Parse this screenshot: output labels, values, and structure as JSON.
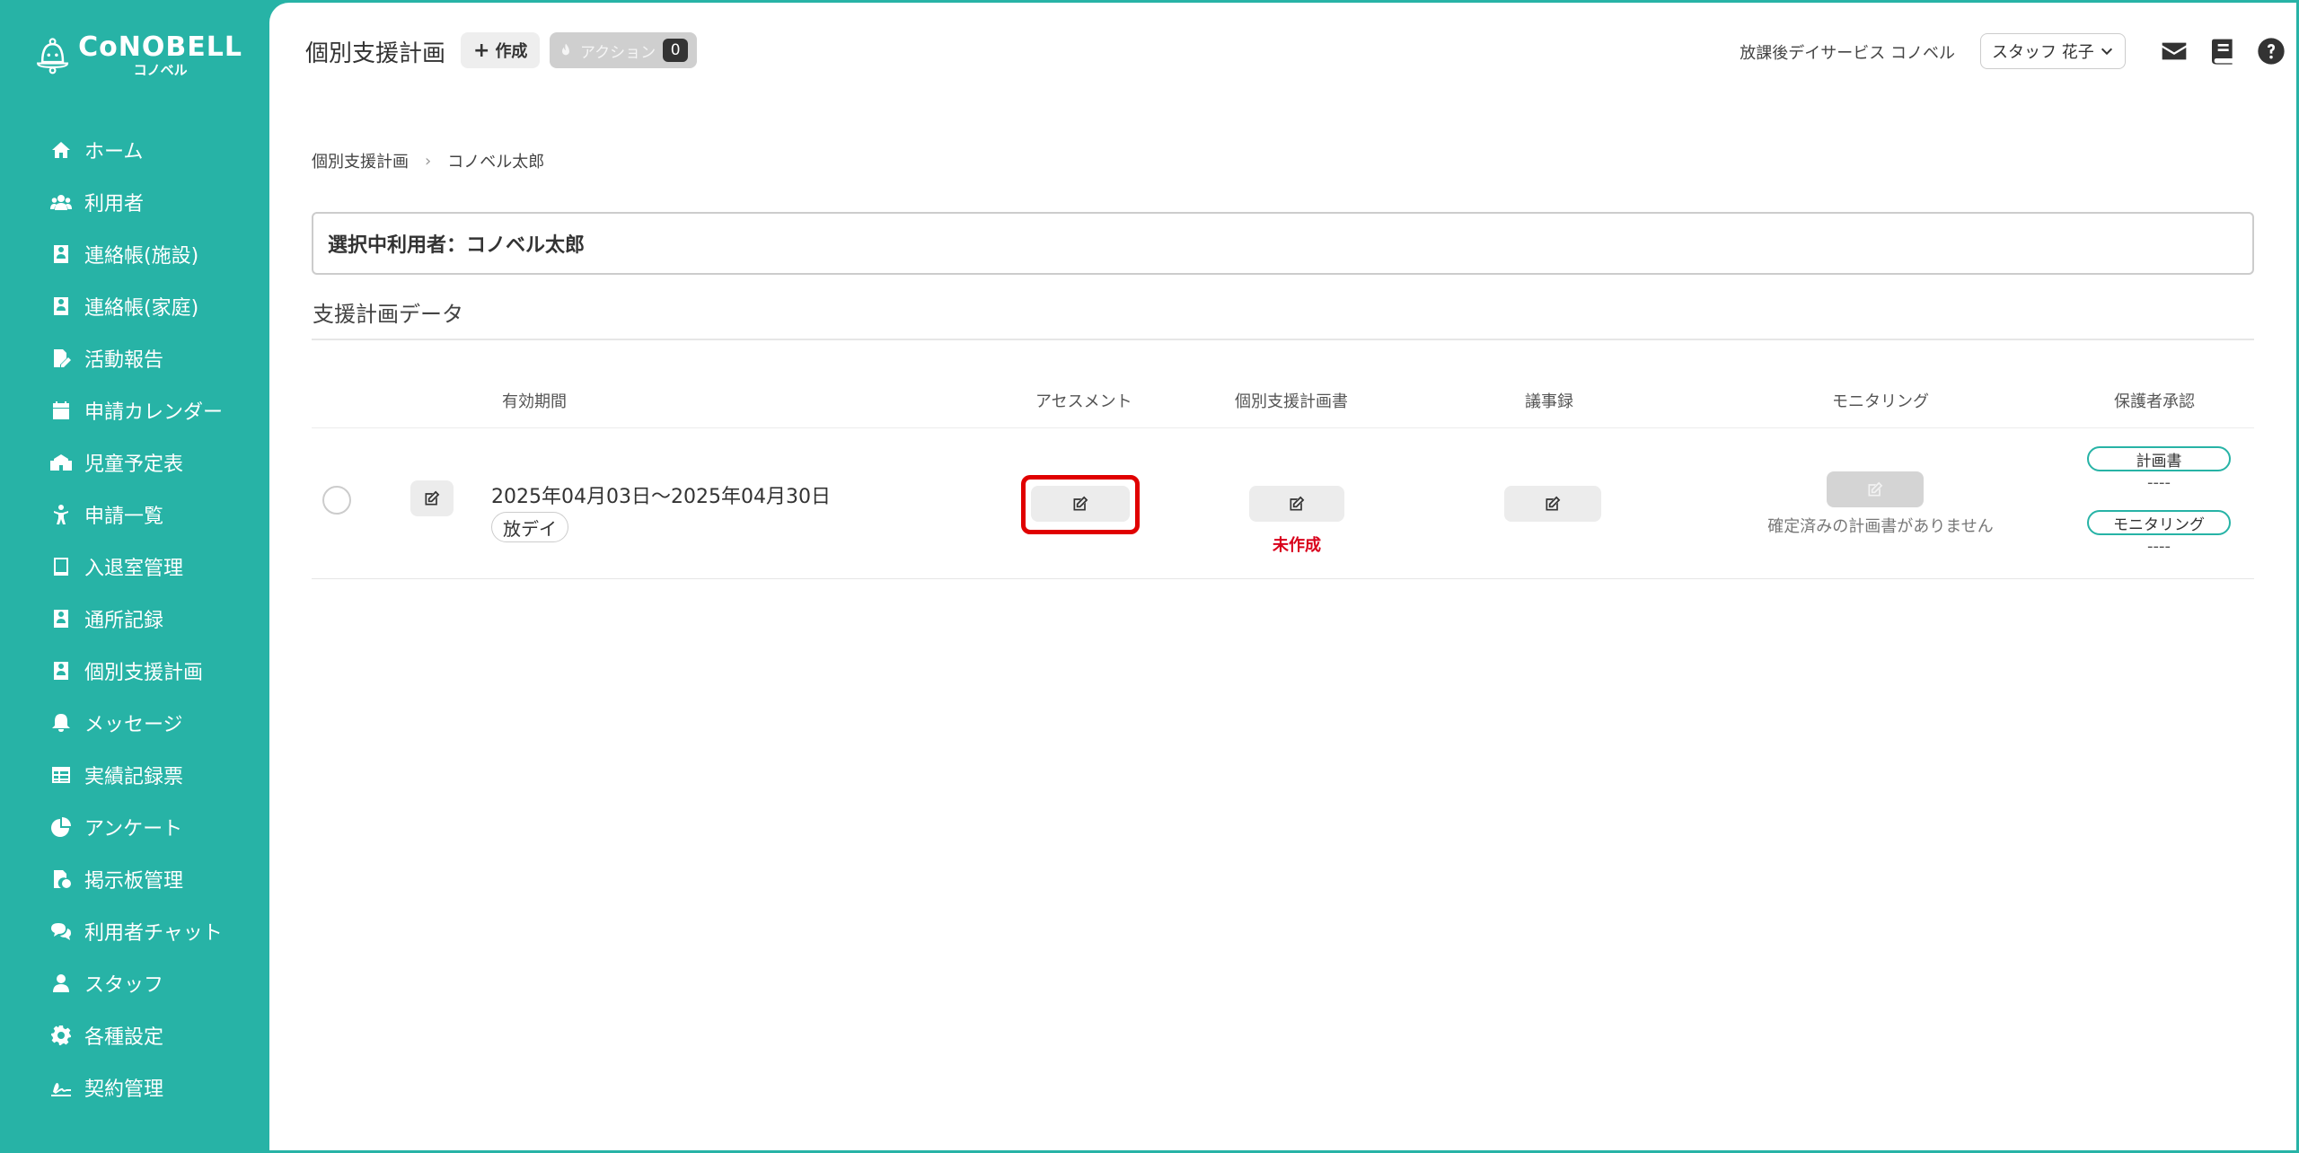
{
  "logo": {
    "main": "CoNOBELL",
    "sub": "コノベル"
  },
  "sidebar": {
    "items": [
      {
        "label": "ホーム",
        "icon": "home-icon"
      },
      {
        "label": "利用者",
        "icon": "users-icon"
      },
      {
        "label": "連絡帳(施設)",
        "icon": "contact-book-icon"
      },
      {
        "label": "連絡帳(家庭)",
        "icon": "contact-book-icon"
      },
      {
        "label": "活動報告",
        "icon": "report-edit-icon"
      },
      {
        "label": "申請カレンダー",
        "icon": "calendar-icon"
      },
      {
        "label": "児童予定表",
        "icon": "school-icon"
      },
      {
        "label": "申請一覧",
        "icon": "child-icon"
      },
      {
        "label": "入退室管理",
        "icon": "tablet-icon"
      },
      {
        "label": "通所記録",
        "icon": "contact-book-icon"
      },
      {
        "label": "個別支援計画",
        "icon": "contact-book-icon"
      },
      {
        "label": "メッセージ",
        "icon": "bell-icon"
      },
      {
        "label": "実績記録票",
        "icon": "table-icon"
      },
      {
        "label": "アンケート",
        "icon": "pie-chart-icon"
      },
      {
        "label": "掲示板管理",
        "icon": "file-settings-icon"
      },
      {
        "label": "利用者チャット",
        "icon": "chat-icon"
      },
      {
        "label": "スタッフ",
        "icon": "staff-icon"
      },
      {
        "label": "各種設定",
        "icon": "gear-icon"
      },
      {
        "label": "契約管理",
        "icon": "signature-icon"
      }
    ]
  },
  "header": {
    "title": "個別支援計画",
    "create_label": "作成",
    "action_label": "アクション",
    "action_count": "0",
    "facility": "放課後デイサービス コノベル",
    "staff": "スタッフ 花子"
  },
  "breadcrumb": {
    "root": "個別支援計画",
    "current": "コノベル太郎"
  },
  "selected_user": "選択中利用者：コノベル太郎",
  "section_title": "支援計画データ",
  "table": {
    "headers": {
      "period": "有効期間",
      "assessment": "アセスメント",
      "plan": "個別支援計画書",
      "minutes": "議事録",
      "monitoring": "モニタリング",
      "approval": "保護者承認"
    },
    "rows": [
      {
        "period": "2025年04月03日～2025年04月30日",
        "service_tag": "放デイ",
        "plan_status": "未作成",
        "monitoring_note": "確定済みの計画書がありません",
        "approval_plan_label": "計画書",
        "approval_plan_value": "----",
        "approval_monitoring_label": "モニタリング",
        "approval_monitoring_value": "----"
      }
    ]
  },
  "colors": {
    "accent": "#27b3a6",
    "highlight": "#e00000",
    "status_red": "#d9001b"
  }
}
